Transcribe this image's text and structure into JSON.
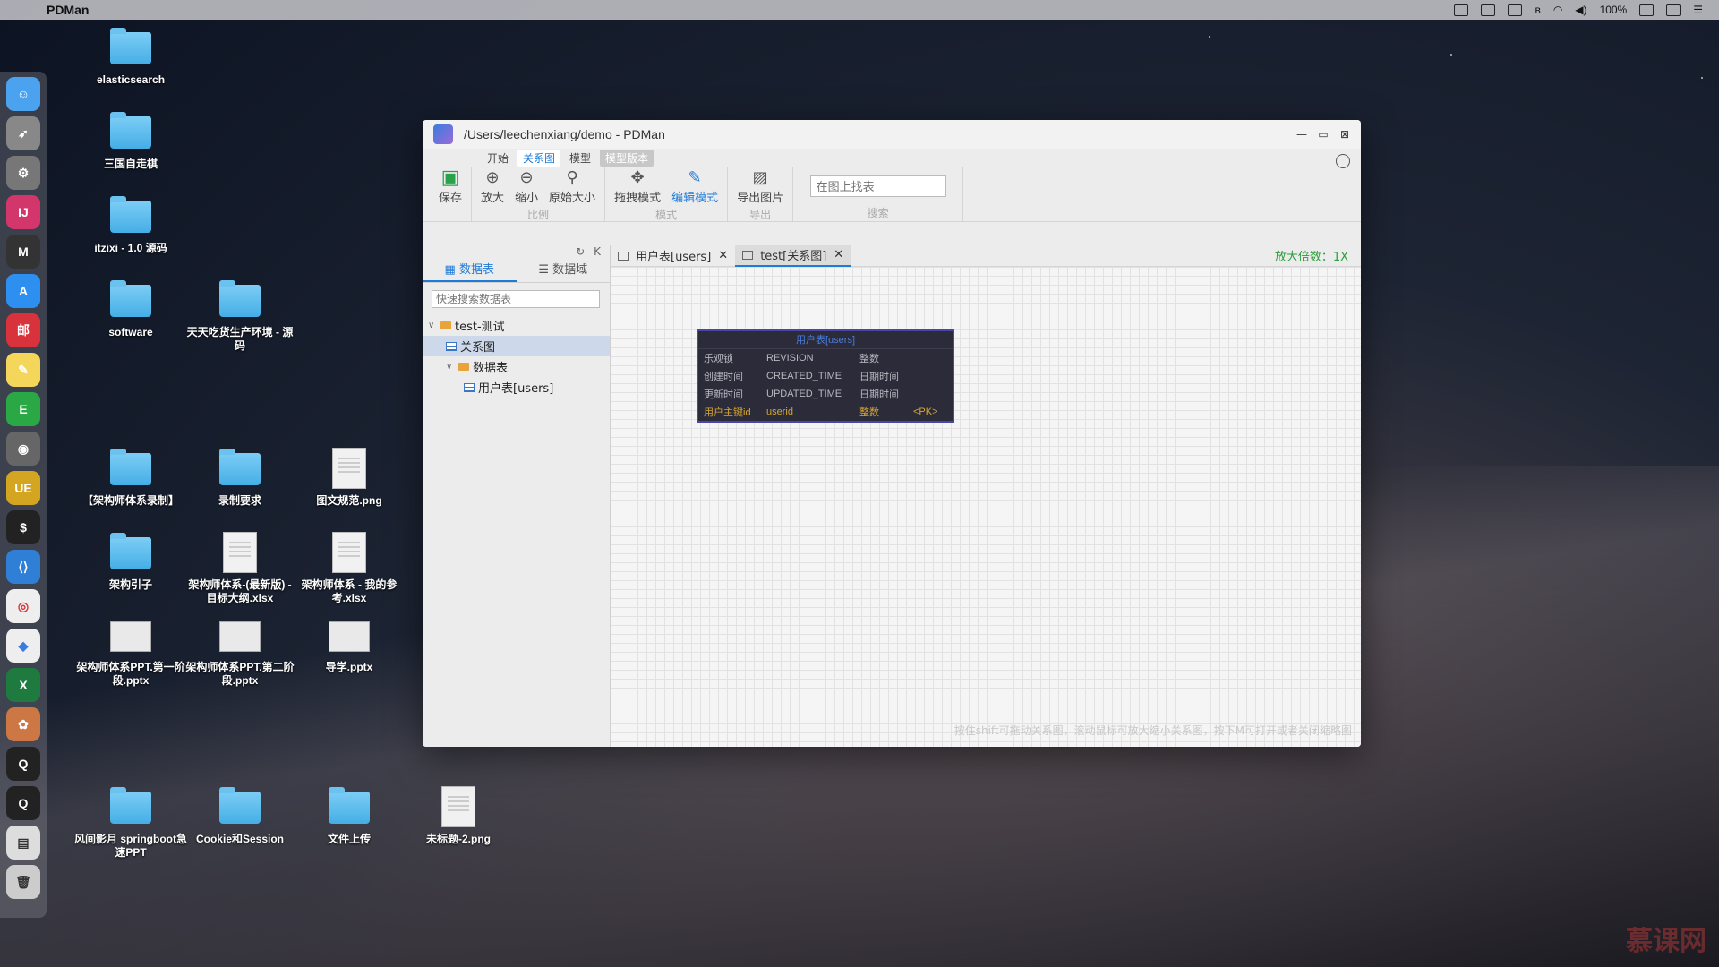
{
  "menubar": {
    "app_name": "PDMan",
    "battery": "100%"
  },
  "desktop": {
    "icons": [
      {
        "label": "elasticsearch",
        "kind": "folder"
      },
      {
        "label": "三国自走棋",
        "kind": "folder"
      },
      {
        "label": "itzixi - 1.0 源码",
        "kind": "folder"
      },
      {
        "label": "software",
        "kind": "folder"
      },
      {
        "label": "天天吃货生产环境 - 源码",
        "kind": "folder"
      },
      {
        "label": "【架构师体系录制】",
        "kind": "folder"
      },
      {
        "label": "录制要求",
        "kind": "folder"
      },
      {
        "label": "图文规范.png",
        "kind": "doc"
      },
      {
        "label": "架构引子",
        "kind": "folder"
      },
      {
        "label": "架构师体系-(最新版) - 目标大纲.xlsx",
        "kind": "doc"
      },
      {
        "label": "架构师体系 - 我的参考.xlsx",
        "kind": "doc"
      },
      {
        "label": "架构师体系PPT.第一阶段.pptx",
        "kind": "slide"
      },
      {
        "label": "架构师体系PPT.第二阶段.pptx",
        "kind": "slide"
      },
      {
        "label": "导学.pptx",
        "kind": "slide"
      },
      {
        "label": "风间影月 springboot急速PPT",
        "kind": "folder"
      },
      {
        "label": "Cookie和Session",
        "kind": "folder"
      },
      {
        "label": "文件上传",
        "kind": "folder"
      },
      {
        "label": "未标题-2.png",
        "kind": "doc"
      }
    ]
  },
  "window": {
    "title": "/Users/leechenxiang/demo - PDMan",
    "menu_tabs": [
      "开始",
      "关系图",
      "模型",
      "模型版本"
    ],
    "ribbon": {
      "save": "保存",
      "zoom_in": "放大",
      "zoom_out": "缩小",
      "original_size": "原始大小",
      "group_scale": "比例",
      "drag_mode": "拖拽模式",
      "edit_mode": "编辑模式",
      "group_mode": "模式",
      "export_image": "导出图片",
      "group_export": "导出",
      "find_placeholder": "在图上找表",
      "group_search": "搜索"
    },
    "sidebar": {
      "tab_tables": "数据表",
      "tab_domains": "数据域",
      "search_placeholder": "快速搜索数据表",
      "tree": {
        "project": "test-测试",
        "diagram": "关系图",
        "tables_folder": "数据表",
        "table": "用户表[users]"
      }
    },
    "doc_tabs": [
      {
        "label": "用户表[users]"
      },
      {
        "label": "test[关系图]"
      }
    ],
    "zoom_info": "放大倍数：1X",
    "entity": {
      "title": "用户表[users]",
      "fields": [
        {
          "name": "乐观锁",
          "code": "REVISION",
          "type": "整数",
          "pk": ""
        },
        {
          "name": "创建时间",
          "code": "CREATED_TIME",
          "type": "日期时间",
          "pk": ""
        },
        {
          "name": "更新时间",
          "code": "UPDATED_TIME",
          "type": "日期时间",
          "pk": ""
        },
        {
          "name": "用户主键id",
          "code": "userid",
          "type": "整数",
          "pk": "<PK>"
        }
      ]
    },
    "canvas_hint": "按住shift可拖动关系图，滚动鼠标可放大缩小关系图，按下M可打开或者关闭缩略图"
  },
  "watermark": "慕课网"
}
